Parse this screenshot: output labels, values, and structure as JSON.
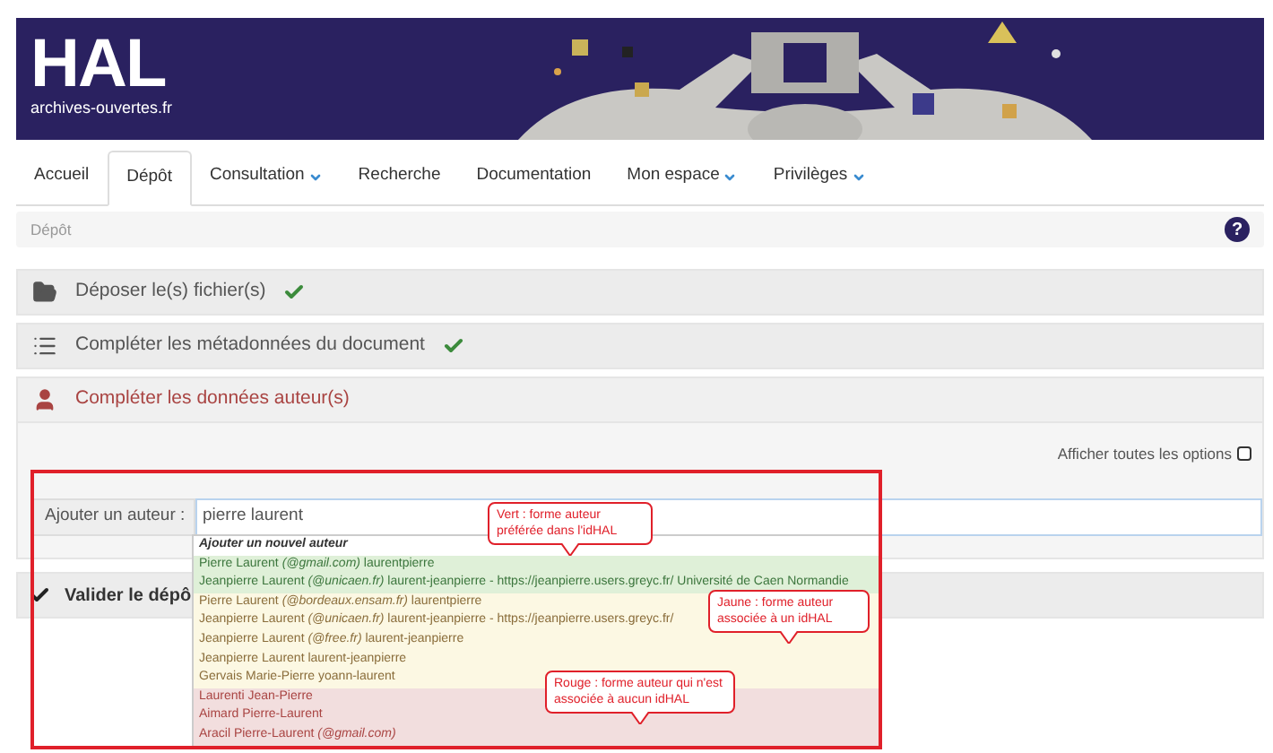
{
  "header": {
    "logo": "HAL",
    "tagline": "archives-ouvertes.fr"
  },
  "nav": [
    {
      "label": "Accueil",
      "selected": false,
      "dropdown": false
    },
    {
      "label": "Dépôt",
      "selected": true,
      "dropdown": false
    },
    {
      "label": "Consultation",
      "selected": false,
      "dropdown": true
    },
    {
      "label": "Recherche",
      "selected": false,
      "dropdown": false
    },
    {
      "label": "Documentation",
      "selected": false,
      "dropdown": false
    },
    {
      "label": "Mon espace",
      "selected": false,
      "dropdown": true
    },
    {
      "label": "Privilèges",
      "selected": false,
      "dropdown": true
    }
  ],
  "breadcrumb": "Dépôt",
  "help": "?",
  "steps": [
    {
      "label": "Déposer le(s) fichier(s)",
      "done": true,
      "active": false
    },
    {
      "label": "Compléter les métadonnées du document",
      "done": true,
      "active": false
    },
    {
      "label": "Compléter les données auteur(s)",
      "done": false,
      "active": true
    }
  ],
  "options": {
    "label": "Afficher toutes les options",
    "checked": false
  },
  "author_field": {
    "label": "Ajouter un auteur :",
    "value": "pierre laurent"
  },
  "next_step": {
    "label": "Valider le dépô"
  },
  "suggestions": [
    {
      "kind": "header",
      "text": "Ajouter un nouvel auteur"
    },
    {
      "kind": "preferred",
      "text": "Pierre Laurent *(@gmail.com)* laurentpierre"
    },
    {
      "kind": "preferred",
      "text": "Jeanpierre Laurent *(@unicaen.fr)* laurent-jeanpierre - https://jeanpierre.users.greyc.fr/ Université de Caen Normandie"
    },
    {
      "kind": "associated",
      "text": "Pierre Laurent *(@bordeaux.ensam.fr)* laurentpierre"
    },
    {
      "kind": "associated",
      "text": "Jeanpierre Laurent *(@unicaen.fr)* laurent-jeanpierre - https://jeanpierre.users.greyc.fr/"
    },
    {
      "kind": "associated",
      "text": "Jeanpierre Laurent *(@free.fr)* laurent-jeanpierre"
    },
    {
      "kind": "associated",
      "text": "Jeanpierre Laurent laurent-jeanpierre"
    },
    {
      "kind": "associated",
      "text": "Gervais Marie-Pierre yoann-laurent"
    },
    {
      "kind": "unassociated",
      "text": "Laurenti Jean-Pierre"
    },
    {
      "kind": "unassociated",
      "text": "Aimard Pierre-Laurent"
    },
    {
      "kind": "unassociated",
      "text": "Aracil Pierre-Laurent *(@gmail.com)*"
    }
  ],
  "callouts": [
    {
      "kind": "green",
      "text": "Vert : forme auteur préférée dans l'idHAL"
    },
    {
      "kind": "yellow",
      "text": "Jaune : forme auteur associée à un idHAL"
    },
    {
      "kind": "red",
      "text": "Rouge : forme auteur qui n'est associée à aucun idHAL"
    }
  ]
}
